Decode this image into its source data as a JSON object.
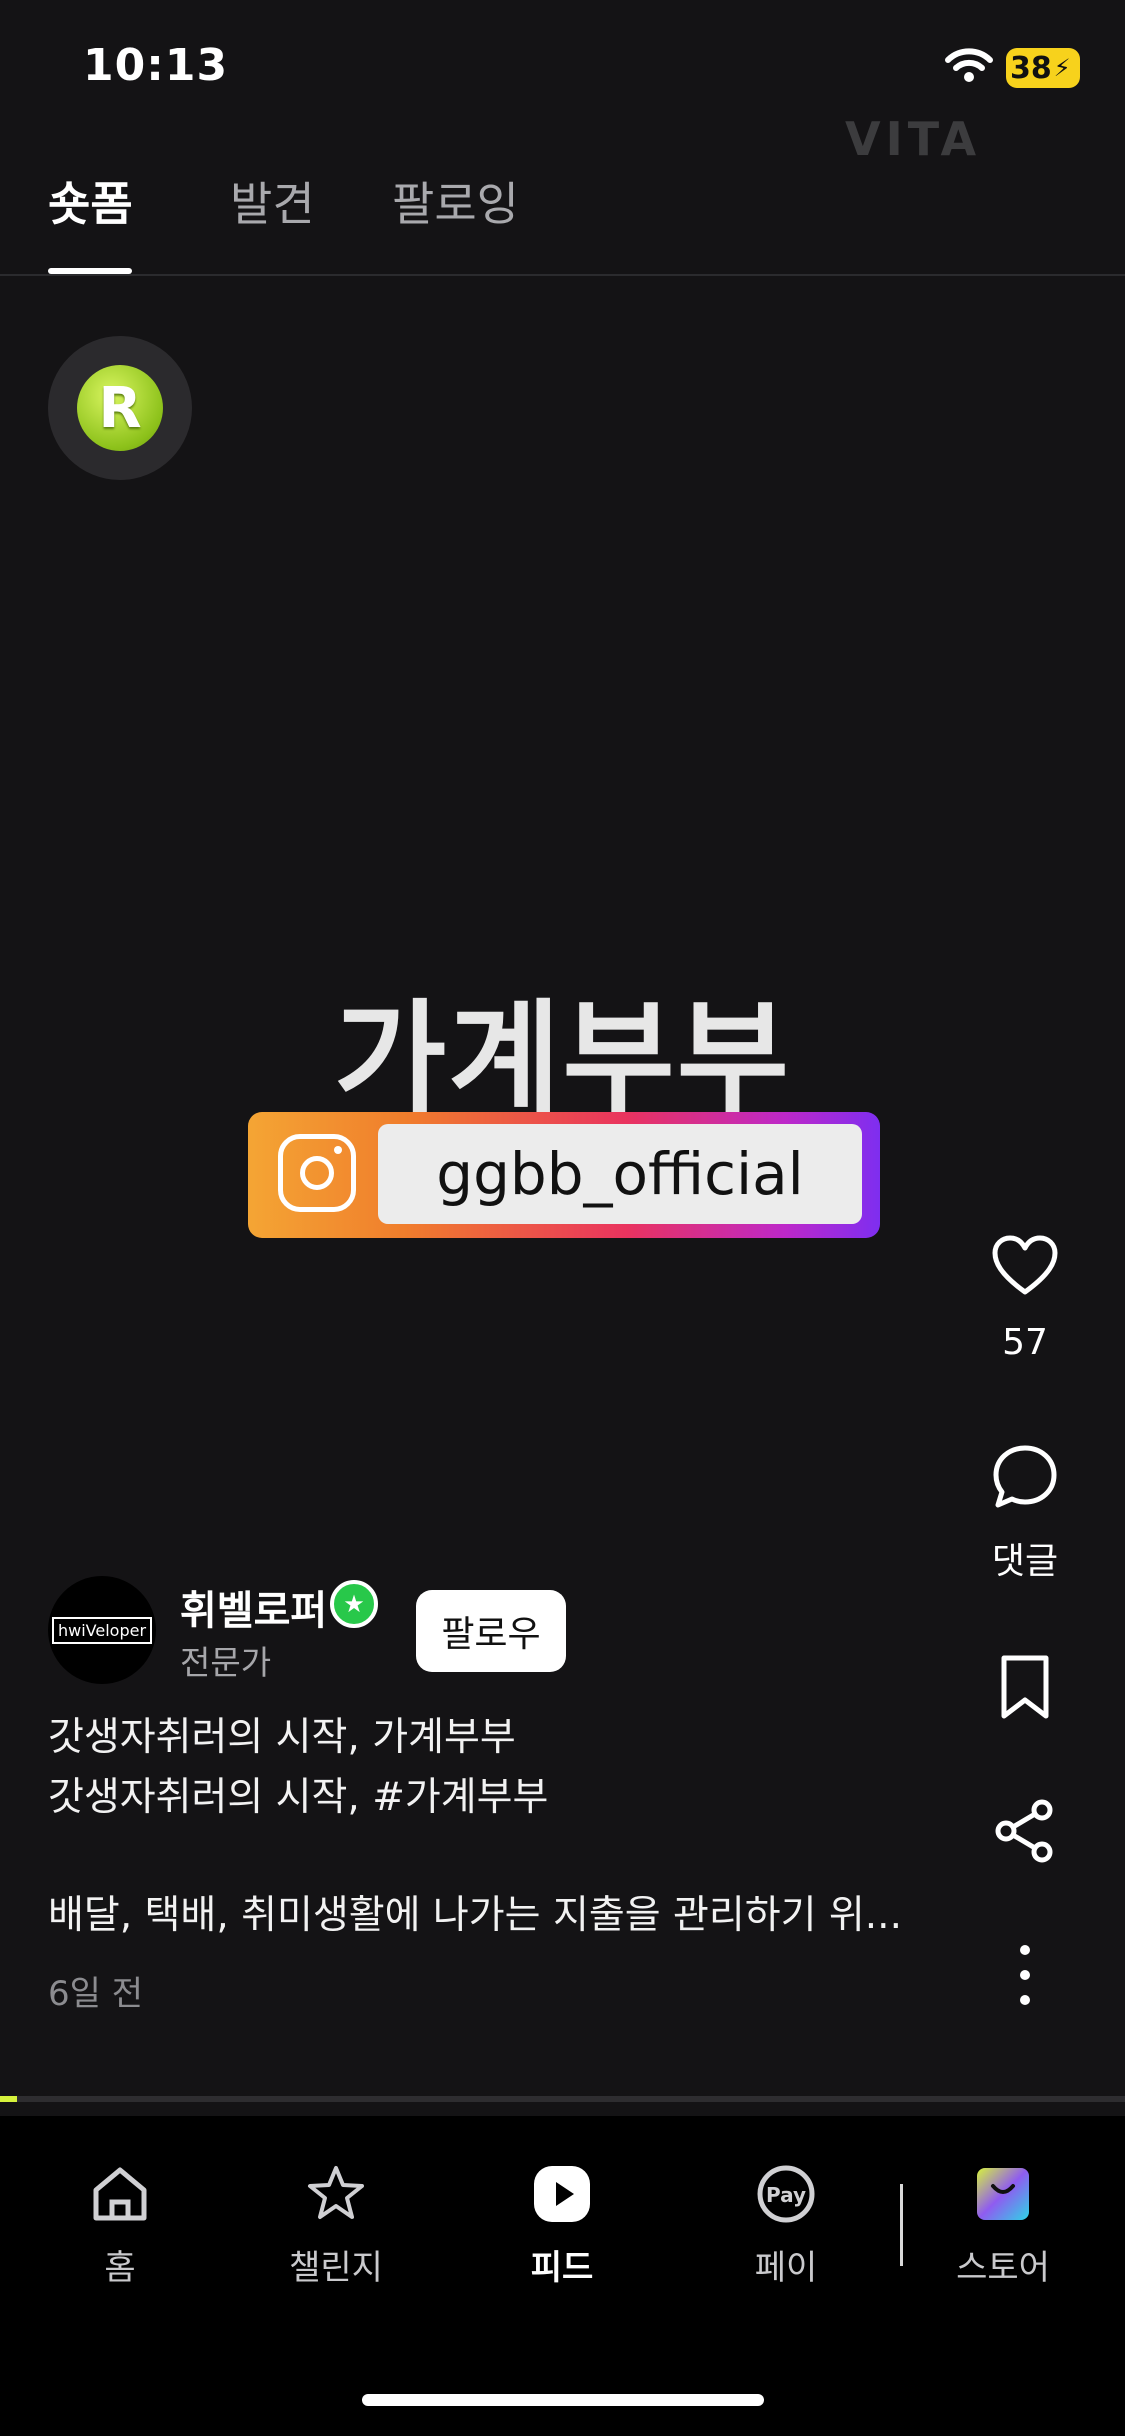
{
  "status_bar": {
    "time": "10:13",
    "battery": "38"
  },
  "watermark": "VITA",
  "top_tabs": [
    {
      "label": "숏폼",
      "active": true
    },
    {
      "label": "발견",
      "active": false
    },
    {
      "label": "팔로잉",
      "active": false
    }
  ],
  "reward_badge": {
    "letter": "R"
  },
  "video": {
    "title_overlay": "가계부부",
    "instagram_handle": "ggbb_official"
  },
  "actions": {
    "like_count": "57",
    "comment_label": "댓글"
  },
  "author": {
    "avatar_text": "hwiVeloper",
    "name": "휘벨로퍼",
    "role": "전문가",
    "follow_label": "팔로우"
  },
  "caption": {
    "line1": "갓생자취러의 시작, 가계부부",
    "line2": "갓생자취러의 시작, #가계부부",
    "line3": "배달, 택배, 취미생활에 나가는 지출을 관리하기 위...",
    "time_ago": "6일 전"
  },
  "progress": {
    "value": 0.015
  },
  "bottom_nav": [
    {
      "label": "홈",
      "icon": "home-icon"
    },
    {
      "label": "챌린지",
      "icon": "star-icon"
    },
    {
      "label": "피드",
      "icon": "play-icon",
      "active": true
    },
    {
      "label": "페이",
      "icon": "pay-icon"
    },
    {
      "label": "스토어",
      "icon": "shopping-bag-icon"
    }
  ],
  "colors": {
    "background": "#141315",
    "accent": "#d6f23c",
    "verified": "#28c84a",
    "battery": "#f7d21c"
  }
}
